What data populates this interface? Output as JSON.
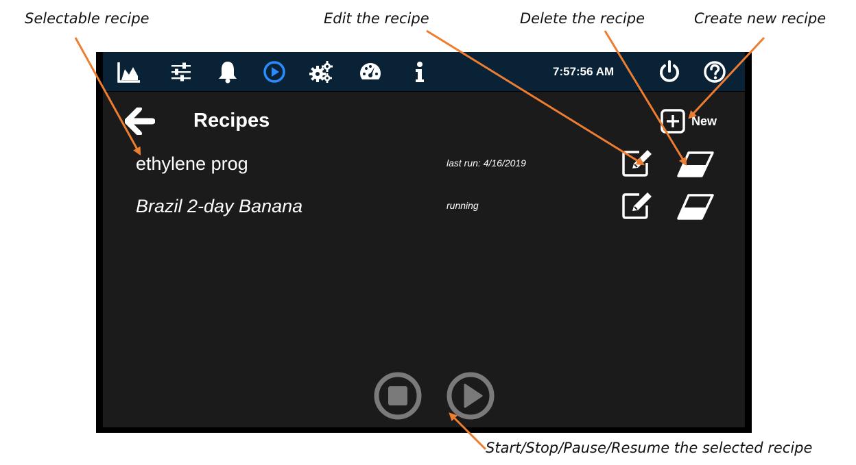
{
  "callouts": {
    "selectable": "Selectable recipe",
    "edit": "Edit the recipe",
    "delete": "Delete the recipe",
    "create": "Create new recipe",
    "controls": "Start/Stop/Pause/Resume the selected recipe"
  },
  "topbar": {
    "clock": "7:57:56 AM",
    "icons": [
      "chart-icon",
      "sliders-icon",
      "bell-icon",
      "play-circle-icon",
      "gears-icon",
      "gauge-icon",
      "info-icon",
      "power-icon",
      "help-icon"
    ],
    "active_color": "#2a8cff"
  },
  "page": {
    "title": "Recipes",
    "new_label": "New"
  },
  "recipes": [
    {
      "name": "ethylene prog",
      "status": "last run: 4/16/2019"
    },
    {
      "name": "Brazil 2-day Banana",
      "status": "running"
    }
  ],
  "colors": {
    "arrow": "#ed7d31",
    "topbar": "#0a2236",
    "panel": "#1b1b1b",
    "disabled_control": "#7a7a7a"
  }
}
